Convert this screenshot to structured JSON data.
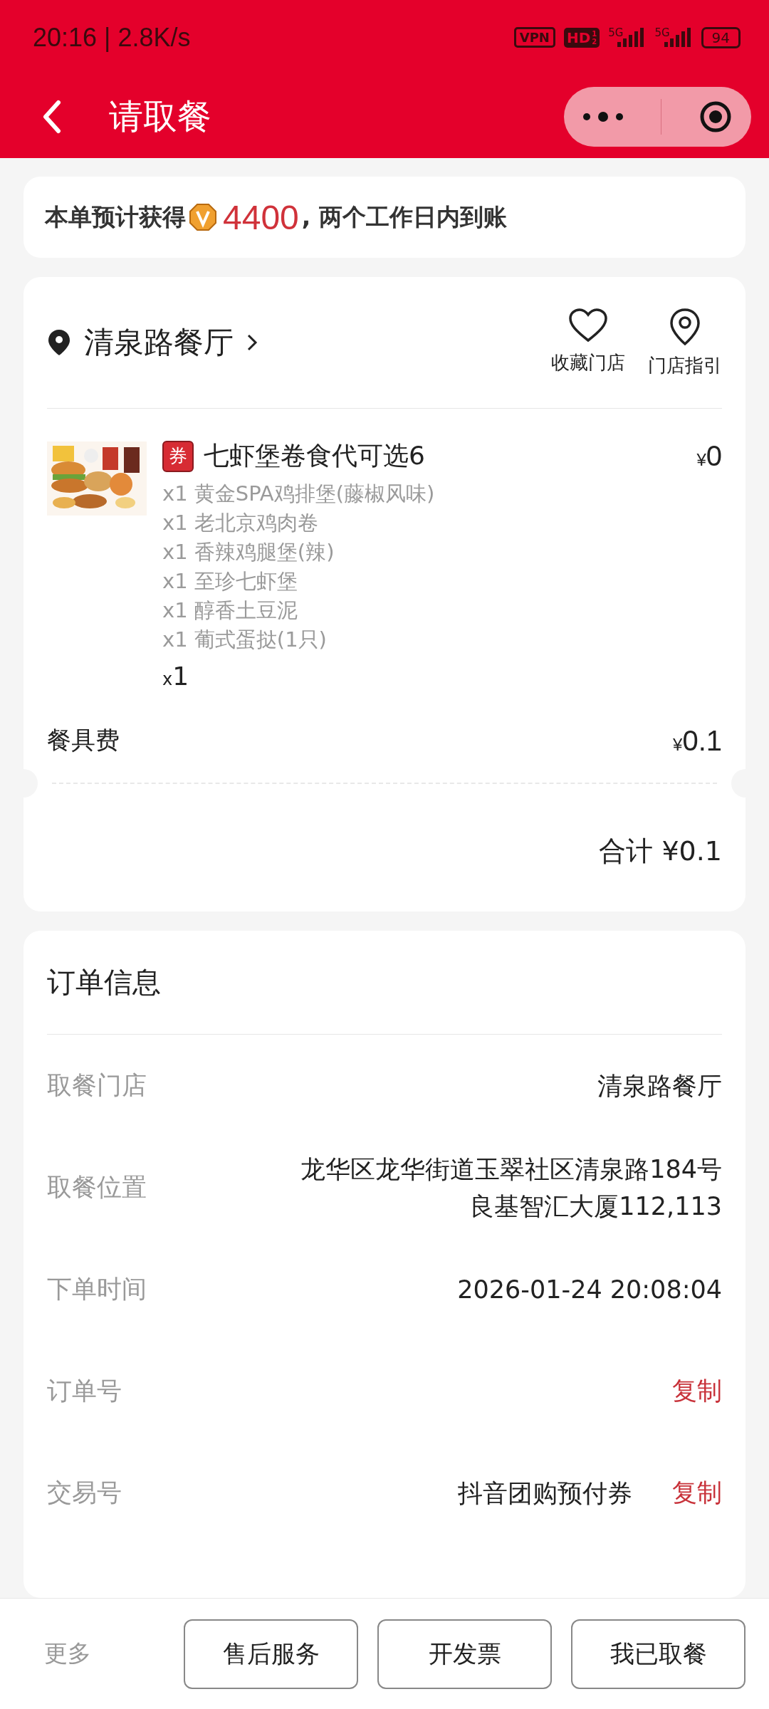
{
  "status_bar": {
    "time": "20:16 | 2.8K/s",
    "vpn": "VPN",
    "hd": "HD",
    "hd_slots": [
      "1",
      "2"
    ],
    "networks": [
      "5G",
      "5G"
    ],
    "battery": "94"
  },
  "nav": {
    "title": "请取餐"
  },
  "bonus": {
    "prefix": "本单预计获得",
    "points": "4400",
    "suffix": ", 两个工作日内到账"
  },
  "store": {
    "name": "清泉路餐厅",
    "actions": [
      {
        "kind": "favorite",
        "label": "收藏门店"
      },
      {
        "kind": "guide",
        "label": "门店指引"
      }
    ]
  },
  "product": {
    "badge": "券",
    "name": "七虾堡卷食代可选6",
    "price_symbol": "¥",
    "price": "0",
    "items": [
      "x1 黄金SPA鸡排堡(藤椒风味)",
      "x1 老北京鸡肉卷",
      "x1 香辣鸡腿堡(辣)",
      "x1 至珍七虾堡",
      "x1 醇香土豆泥",
      "x1 葡式蛋挞(1只)"
    ],
    "qty_prefix": "x",
    "qty": "1"
  },
  "fee": {
    "label": "餐具费",
    "symbol": "¥",
    "amount": "0.1"
  },
  "total": "合计 ¥0.1",
  "order_info": {
    "title": "订单信息",
    "rows": [
      {
        "label": "取餐门店",
        "lines": [
          "清泉路餐厅"
        ]
      },
      {
        "label": "取餐位置",
        "lines": [
          "龙华区龙华街道玉翠社区清泉路184号",
          "良基智汇大厦112,113"
        ]
      },
      {
        "label": "下单时间",
        "lines": [
          "2026-01-24 20:08:04"
        ]
      },
      {
        "label": "订单号",
        "action": "复制"
      },
      {
        "label": "交易号",
        "lines": [
          "抖音团购预付券"
        ],
        "action": "复制"
      }
    ]
  },
  "bottom": {
    "more": "更多",
    "buttons": [
      "售后服务",
      "开发票",
      "我已取餐"
    ]
  }
}
